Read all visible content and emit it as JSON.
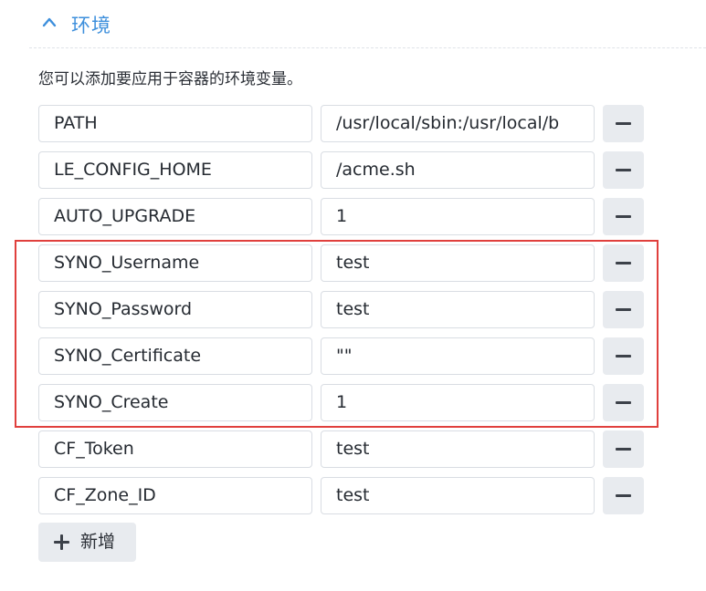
{
  "section": {
    "title": "环境",
    "expanded": true,
    "icon": "chevron-up-icon",
    "accent_color": "#3d8fdc"
  },
  "description": "您可以添加要应用于容器的环境变量。",
  "env_vars": [
    {
      "key": "PATH",
      "value": "/usr/local/sbin:/usr/local/b"
    },
    {
      "key": "LE_CONFIG_HOME",
      "value": "/acme.sh"
    },
    {
      "key": "AUTO_UPGRADE",
      "value": "1"
    },
    {
      "key": "SYNO_Username",
      "value": "test"
    },
    {
      "key": "SYNO_Password",
      "value": "test"
    },
    {
      "key": "SYNO_Certificate",
      "value": "\"\""
    },
    {
      "key": "SYNO_Create",
      "value": "1"
    },
    {
      "key": "CF_Token",
      "value": "test"
    },
    {
      "key": "CF_Zone_ID",
      "value": "test"
    }
  ],
  "remove_icon": "minus-icon",
  "add_button": {
    "label": "新增",
    "icon": "plus-icon"
  },
  "highlight": {
    "color": "#e0403d",
    "rows": [
      "SYNO_Username",
      "SYNO_Password",
      "SYNO_Certificate",
      "SYNO_Create"
    ]
  }
}
